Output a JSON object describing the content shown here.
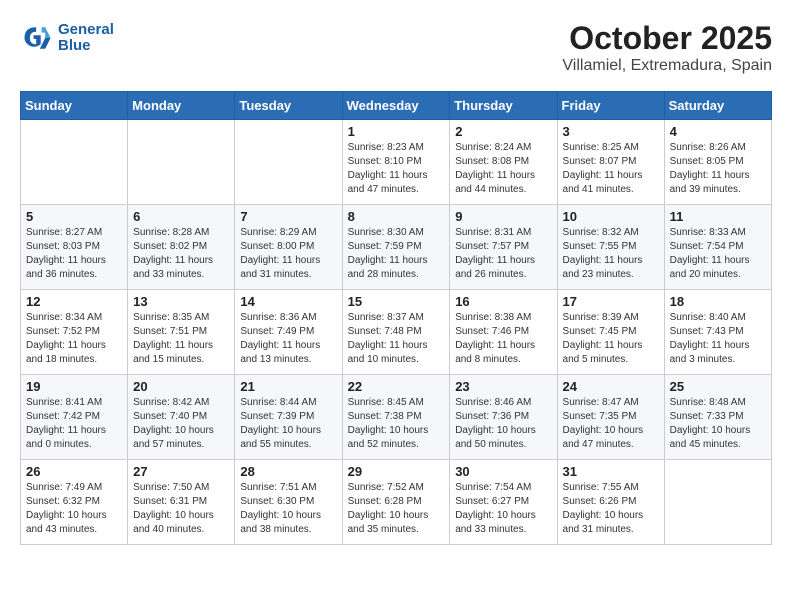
{
  "header": {
    "logo_line1": "General",
    "logo_line2": "Blue",
    "month": "October 2025",
    "location": "Villamiel, Extremadura, Spain"
  },
  "days_of_week": [
    "Sunday",
    "Monday",
    "Tuesday",
    "Wednesday",
    "Thursday",
    "Friday",
    "Saturday"
  ],
  "weeks": [
    [
      {
        "day": "",
        "info": ""
      },
      {
        "day": "",
        "info": ""
      },
      {
        "day": "",
        "info": ""
      },
      {
        "day": "1",
        "info": "Sunrise: 8:23 AM\nSunset: 8:10 PM\nDaylight: 11 hours and 47 minutes."
      },
      {
        "day": "2",
        "info": "Sunrise: 8:24 AM\nSunset: 8:08 PM\nDaylight: 11 hours and 44 minutes."
      },
      {
        "day": "3",
        "info": "Sunrise: 8:25 AM\nSunset: 8:07 PM\nDaylight: 11 hours and 41 minutes."
      },
      {
        "day": "4",
        "info": "Sunrise: 8:26 AM\nSunset: 8:05 PM\nDaylight: 11 hours and 39 minutes."
      }
    ],
    [
      {
        "day": "5",
        "info": "Sunrise: 8:27 AM\nSunset: 8:03 PM\nDaylight: 11 hours and 36 minutes."
      },
      {
        "day": "6",
        "info": "Sunrise: 8:28 AM\nSunset: 8:02 PM\nDaylight: 11 hours and 33 minutes."
      },
      {
        "day": "7",
        "info": "Sunrise: 8:29 AM\nSunset: 8:00 PM\nDaylight: 11 hours and 31 minutes."
      },
      {
        "day": "8",
        "info": "Sunrise: 8:30 AM\nSunset: 7:59 PM\nDaylight: 11 hours and 28 minutes."
      },
      {
        "day": "9",
        "info": "Sunrise: 8:31 AM\nSunset: 7:57 PM\nDaylight: 11 hours and 26 minutes."
      },
      {
        "day": "10",
        "info": "Sunrise: 8:32 AM\nSunset: 7:55 PM\nDaylight: 11 hours and 23 minutes."
      },
      {
        "day": "11",
        "info": "Sunrise: 8:33 AM\nSunset: 7:54 PM\nDaylight: 11 hours and 20 minutes."
      }
    ],
    [
      {
        "day": "12",
        "info": "Sunrise: 8:34 AM\nSunset: 7:52 PM\nDaylight: 11 hours and 18 minutes."
      },
      {
        "day": "13",
        "info": "Sunrise: 8:35 AM\nSunset: 7:51 PM\nDaylight: 11 hours and 15 minutes."
      },
      {
        "day": "14",
        "info": "Sunrise: 8:36 AM\nSunset: 7:49 PM\nDaylight: 11 hours and 13 minutes."
      },
      {
        "day": "15",
        "info": "Sunrise: 8:37 AM\nSunset: 7:48 PM\nDaylight: 11 hours and 10 minutes."
      },
      {
        "day": "16",
        "info": "Sunrise: 8:38 AM\nSunset: 7:46 PM\nDaylight: 11 hours and 8 minutes."
      },
      {
        "day": "17",
        "info": "Sunrise: 8:39 AM\nSunset: 7:45 PM\nDaylight: 11 hours and 5 minutes."
      },
      {
        "day": "18",
        "info": "Sunrise: 8:40 AM\nSunset: 7:43 PM\nDaylight: 11 hours and 3 minutes."
      }
    ],
    [
      {
        "day": "19",
        "info": "Sunrise: 8:41 AM\nSunset: 7:42 PM\nDaylight: 11 hours and 0 minutes."
      },
      {
        "day": "20",
        "info": "Sunrise: 8:42 AM\nSunset: 7:40 PM\nDaylight: 10 hours and 57 minutes."
      },
      {
        "day": "21",
        "info": "Sunrise: 8:44 AM\nSunset: 7:39 PM\nDaylight: 10 hours and 55 minutes."
      },
      {
        "day": "22",
        "info": "Sunrise: 8:45 AM\nSunset: 7:38 PM\nDaylight: 10 hours and 52 minutes."
      },
      {
        "day": "23",
        "info": "Sunrise: 8:46 AM\nSunset: 7:36 PM\nDaylight: 10 hours and 50 minutes."
      },
      {
        "day": "24",
        "info": "Sunrise: 8:47 AM\nSunset: 7:35 PM\nDaylight: 10 hours and 47 minutes."
      },
      {
        "day": "25",
        "info": "Sunrise: 8:48 AM\nSunset: 7:33 PM\nDaylight: 10 hours and 45 minutes."
      }
    ],
    [
      {
        "day": "26",
        "info": "Sunrise: 7:49 AM\nSunset: 6:32 PM\nDaylight: 10 hours and 43 minutes."
      },
      {
        "day": "27",
        "info": "Sunrise: 7:50 AM\nSunset: 6:31 PM\nDaylight: 10 hours and 40 minutes."
      },
      {
        "day": "28",
        "info": "Sunrise: 7:51 AM\nSunset: 6:30 PM\nDaylight: 10 hours and 38 minutes."
      },
      {
        "day": "29",
        "info": "Sunrise: 7:52 AM\nSunset: 6:28 PM\nDaylight: 10 hours and 35 minutes."
      },
      {
        "day": "30",
        "info": "Sunrise: 7:54 AM\nSunset: 6:27 PM\nDaylight: 10 hours and 33 minutes."
      },
      {
        "day": "31",
        "info": "Sunrise: 7:55 AM\nSunset: 6:26 PM\nDaylight: 10 hours and 31 minutes."
      },
      {
        "day": "",
        "info": ""
      }
    ]
  ]
}
